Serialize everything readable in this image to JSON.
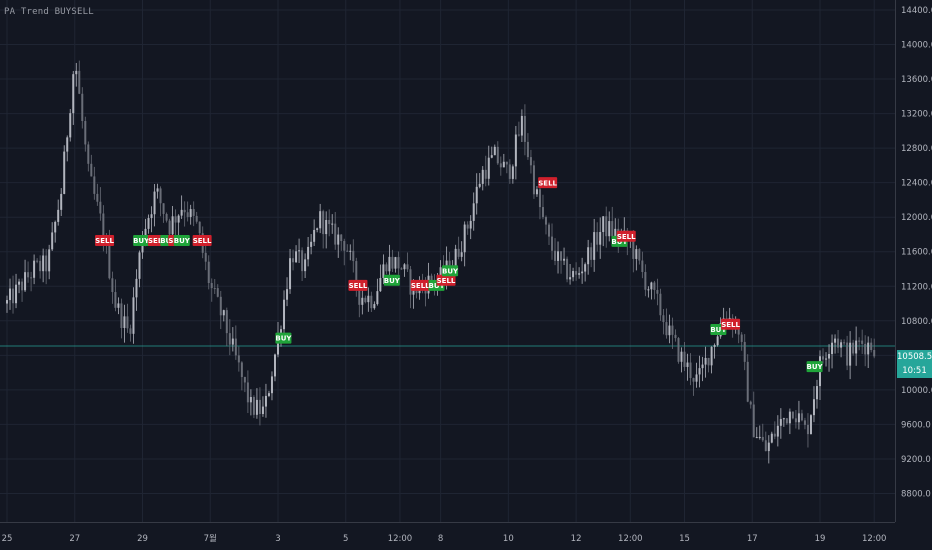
{
  "indicator": {
    "title": "PA Trend BUYSELL"
  },
  "price_axis": {
    "last_price": "10508.5",
    "countdown": "10:51"
  },
  "colors": {
    "background": "#131722",
    "grid": "#1f2533",
    "up_candle": "#b2b5be",
    "down_candle": "#6a6e78",
    "buy": "#1fa43a",
    "sell": "#d0202c",
    "last_price_line": "#26a69a"
  },
  "chart_data": {
    "type": "candlestick",
    "title": "PA Trend BUYSELL",
    "ylim": [
      8600,
      14600
    ],
    "y_ticks": [
      8800,
      9200,
      9600,
      10000,
      10400,
      10800,
      11200,
      11600,
      12000,
      12400,
      12800,
      13200,
      13600,
      14000,
      14400
    ],
    "y_tick_labels": [
      "8800.0",
      "9200.0",
      "9600.0",
      "10000.0",
      "10400.0",
      "10800.0",
      "11200.0",
      "11600.0",
      "12000.0",
      "12400.0",
      "12800.0",
      "13200.0",
      "13600.0",
      "14000.0",
      "14400.0"
    ],
    "x_tick_labels": [
      "25",
      "27",
      "29",
      "7월",
      "3",
      "5",
      "12:00",
      "8",
      "10",
      "12",
      "12:00",
      "15",
      "17",
      "19",
      "12:00"
    ],
    "x_tick_index": [
      0,
      5,
      10,
      15,
      20,
      25,
      29,
      32,
      37,
      42,
      46,
      50,
      55,
      60,
      64
    ],
    "last_price": 10508.5,
    "price_path": [
      [
        0,
        11000
      ],
      [
        1,
        11200
      ],
      [
        2,
        11400
      ],
      [
        3,
        11450
      ],
      [
        4,
        12300
      ],
      [
        5,
        13850
      ],
      [
        6,
        12500
      ],
      [
        7,
        11900
      ],
      [
        8,
        11000
      ],
      [
        9,
        10650
      ],
      [
        10,
        11800
      ],
      [
        11,
        12300
      ],
      [
        12,
        11900
      ],
      [
        13,
        12150
      ],
      [
        14,
        11900
      ],
      [
        15,
        11200
      ],
      [
        16,
        10800
      ],
      [
        17,
        10300
      ],
      [
        18,
        9800
      ],
      [
        19,
        9750
      ],
      [
        20,
        10600
      ],
      [
        21,
        11600
      ],
      [
        22,
        11400
      ],
      [
        23,
        12000
      ],
      [
        24,
        11800
      ],
      [
        25,
        11700
      ],
      [
        26,
        11100
      ],
      [
        27,
        11050
      ],
      [
        28,
        11500
      ],
      [
        29,
        11450
      ],
      [
        30,
        11150
      ],
      [
        31,
        11250
      ],
      [
        32,
        11300
      ],
      [
        33,
        11500
      ],
      [
        34,
        11900
      ],
      [
        35,
        12500
      ],
      [
        36,
        12700
      ],
      [
        37,
        12500
      ],
      [
        38,
        13100
      ],
      [
        39,
        12300
      ],
      [
        40,
        11700
      ],
      [
        41,
        11400
      ],
      [
        42,
        11300
      ],
      [
        43,
        11600
      ],
      [
        44,
        11900
      ],
      [
        45,
        11800
      ],
      [
        46,
        11700
      ],
      [
        47,
        11300
      ],
      [
        48,
        11000
      ],
      [
        49,
        10600
      ],
      [
        50,
        10300
      ],
      [
        51,
        10100
      ],
      [
        52,
        10500
      ],
      [
        53,
        10900
      ],
      [
        54,
        10700
      ],
      [
        55,
        9600
      ],
      [
        56,
        9300
      ],
      [
        57,
        9600
      ],
      [
        58,
        9800
      ],
      [
        59,
        9500
      ],
      [
        60,
        10300
      ],
      [
        61,
        10650
      ],
      [
        62,
        10400
      ],
      [
        63,
        10550
      ],
      [
        64,
        10508
      ]
    ],
    "signals": [
      {
        "type": "SELL",
        "x": 7.2,
        "price": 11730
      },
      {
        "type": "BUY",
        "x": 9.9,
        "price": 11730
      },
      {
        "type": "SELL",
        "x": 11.1,
        "price": 11730
      },
      {
        "type": "BUY",
        "x": 11.9,
        "price": 11730
      },
      {
        "type": "SELL",
        "x": 12.6,
        "price": 11730
      },
      {
        "type": "BUY",
        "x": 12.9,
        "price": 11730
      },
      {
        "type": "SELL",
        "x": 14.4,
        "price": 11730
      },
      {
        "type": "BUY",
        "x": 20.4,
        "price": 10600
      },
      {
        "type": "SELL",
        "x": 25.9,
        "price": 11210
      },
      {
        "type": "BUY",
        "x": 28.4,
        "price": 11270
      },
      {
        "type": "SELL",
        "x": 30.5,
        "price": 11210
      },
      {
        "type": "BUY",
        "x": 31.7,
        "price": 11210
      },
      {
        "type": "SELL",
        "x": 32.4,
        "price": 11270
      },
      {
        "type": "BUY",
        "x": 32.7,
        "price": 11380
      },
      {
        "type": "SELL",
        "x": 39.9,
        "price": 12400
      },
      {
        "type": "BUY",
        "x": 45.2,
        "price": 11720
      },
      {
        "type": "SELL",
        "x": 45.7,
        "price": 11780
      },
      {
        "type": "BUY",
        "x": 52.5,
        "price": 10700
      },
      {
        "type": "SELL",
        "x": 53.4,
        "price": 10760
      },
      {
        "type": "BUY",
        "x": 59.6,
        "price": 10270
      }
    ]
  }
}
